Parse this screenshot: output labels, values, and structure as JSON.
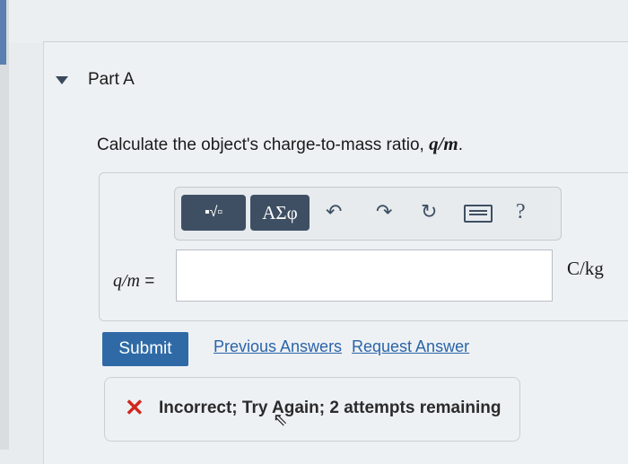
{
  "part": {
    "title": "Part A"
  },
  "question": {
    "prompt_text": "Calculate the object's charge-to-mass ratio, ",
    "prompt_math": "q/m",
    "prompt_end": "."
  },
  "toolbar": {
    "template_icon": "▪√▫",
    "greek_label": "ΑΣφ",
    "undo_icon": "↶",
    "redo_icon": "↷",
    "reset_icon": "↻",
    "help_label": "?"
  },
  "answer": {
    "label": "q/m",
    "equals": " =",
    "value": "",
    "unit": "C/kg"
  },
  "actions": {
    "submit_label": "Submit",
    "previous_answers_label": "Previous Answers",
    "request_answer_label": "Request Answer"
  },
  "feedback": {
    "icon": "✕",
    "message": "Incorrect; Try Again; 2 attempts remaining"
  },
  "colors": {
    "accent": "#2f6aa6",
    "toolbar": "#3f4f63",
    "error": "#d0271d"
  }
}
